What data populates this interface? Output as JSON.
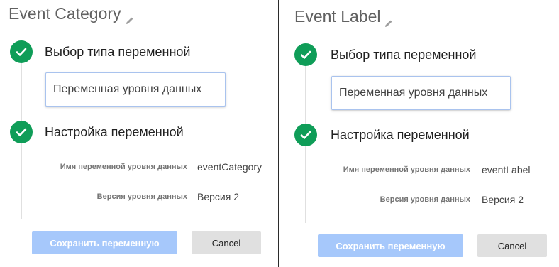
{
  "panels": [
    {
      "title": "Event Category",
      "step1_label": "Выбор типа переменной",
      "variable_type": "Переменная уровня данных",
      "step2_label": "Настройка переменной",
      "dl_name_label": "Имя переменной уровня данных",
      "dl_name_value": "eventCategory",
      "dl_version_label": "Версия уровня данных",
      "dl_version_value": "Версия 2",
      "save_label": "Сохранить переменную",
      "cancel_label": "Cancel"
    },
    {
      "title": "Event Label",
      "step1_label": "Выбор типа переменной",
      "variable_type": "Переменная уровня данных",
      "step2_label": "Настройка переменной",
      "dl_name_label": "Имя переменной уровня данных",
      "dl_name_value": "eventLabel",
      "dl_version_label": "Версия уровня данных",
      "dl_version_value": "Версия 2",
      "save_label": "Сохранить переменную",
      "cancel_label": "Cancel"
    }
  ],
  "colors": {
    "check_green": "#0f9d58",
    "save_button_disabled": "#a6c8fb",
    "cancel_button": "#e0e0e0",
    "title_gray": "#616161"
  },
  "icons": [
    "pencil-icon",
    "checkmark-icon"
  ]
}
